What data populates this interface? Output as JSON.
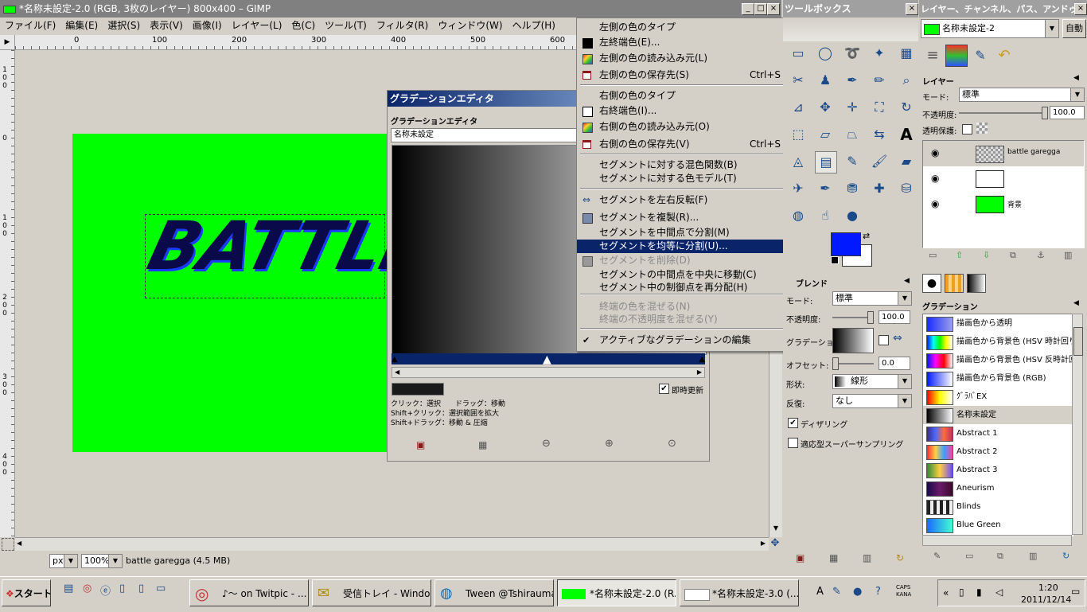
{
  "gimp_window": {
    "title": "*名称未設定-2.0 (RGB, 3枚のレイヤー) 800x400 – GIMP",
    "menu": [
      "ファイル(F)",
      "編集(E)",
      "選択(S)",
      "表示(V)",
      "画像(I)",
      "レイヤー(L)",
      "色(C)",
      "ツール(T)",
      "フィルタ(R)",
      "ウィンドウ(W)",
      "ヘルプ(H)"
    ],
    "ruler_top": [
      "0",
      "100",
      "200",
      "300",
      "400",
      "500",
      "600"
    ],
    "ruler_left": [
      [
        "1",
        "0",
        "0"
      ],
      [
        "0"
      ],
      [
        "1",
        "0",
        "0"
      ],
      [
        "2",
        "0",
        "0"
      ],
      [
        "3",
        "0",
        "0"
      ],
      [
        "4",
        "0",
        "0"
      ]
    ],
    "canvas_color": "#00ff00",
    "canvas_text": "BATTLE",
    "status_unit": "px",
    "status_zoom": "100%",
    "status_text": "battle garegga (4.5 MB)"
  },
  "gradient_editor": {
    "title": "グラデーションエディタ",
    "heading": "グラデーションエディタ",
    "name_value": "名称未設定",
    "hint1": "クリック：選択　　ドラッグ：移動",
    "hint2": "Shift+クリック：選択範囲を拡大",
    "hint3": "Shift+ドラッグ：移動 & 圧縮",
    "instant_update": "即時更新",
    "instant_checked": "✔"
  },
  "context_menu": {
    "items": [
      {
        "label": "左側の色のタイプ",
        "shortcut": "",
        "arrow": "▶",
        "icon": "none"
      },
      {
        "label": "左終端色(E)...",
        "shortcut": "",
        "arrow": "",
        "icon": "black-swatch"
      },
      {
        "label": "左側の色の読み込み元(L)",
        "shortcut": "",
        "arrow": "▶",
        "icon": "palette"
      },
      {
        "label": "左側の色の保存先(S)",
        "shortcut": "Ctrl+S",
        "arrow": "▶",
        "icon": "save"
      },
      {
        "label": "右側の色のタイプ",
        "shortcut": "",
        "arrow": "▶",
        "icon": "none"
      },
      {
        "label": "右終端色(I)...",
        "shortcut": "",
        "arrow": "",
        "icon": "white-swatch"
      },
      {
        "label": "右側の色の読み込み元(O)",
        "shortcut": "",
        "arrow": "▶",
        "icon": "palette"
      },
      {
        "label": "右側の色の保存先(V)",
        "shortcut": "Ctrl+S",
        "arrow": "▶",
        "icon": "save"
      },
      {
        "label": "セグメントに対する混色関数(B)",
        "shortcut": "",
        "arrow": "▶",
        "icon": "none"
      },
      {
        "label": "セグメントに対する色モデル(T)",
        "shortcut": "",
        "arrow": "▶",
        "icon": "none"
      },
      {
        "label": "セグメントを左右反転(F)",
        "shortcut": "",
        "arrow": "",
        "icon": "flip"
      },
      {
        "label": "セグメントを複製(R)...",
        "shortcut": "",
        "arrow": "",
        "icon": "duplicate"
      },
      {
        "label": "セグメントを中間点で分割(M)",
        "shortcut": "",
        "arrow": "",
        "icon": "none"
      },
      {
        "label": "セグメントを均等に分割(U)...",
        "shortcut": "",
        "arrow": "",
        "icon": "none"
      },
      {
        "label": "セグメントを削除(D)",
        "shortcut": "",
        "arrow": "",
        "icon": "trash"
      },
      {
        "label": "セグメントの中間点を中央に移動(C)",
        "shortcut": "",
        "arrow": "",
        "icon": "none"
      },
      {
        "label": "セグメント中の制御点を再分配(H)",
        "shortcut": "",
        "arrow": "",
        "icon": "none"
      },
      {
        "label": "終端の色を混ぜる(N)",
        "shortcut": "",
        "arrow": "",
        "icon": "none"
      },
      {
        "label": "終端の不透明度を混ぜる(Y)",
        "shortcut": "",
        "arrow": "",
        "icon": "none"
      },
      {
        "label": "アクティブなグラデーションの編集",
        "shortcut": "",
        "arrow": "",
        "icon": "check"
      }
    ]
  },
  "toolbox": {
    "title": "ツールボックス",
    "blend_title": "ブレンド",
    "mode_label": "モード:",
    "mode_value": "標準",
    "opacity_label": "不透明度:",
    "opacity_value": "100.0",
    "gradient_label": "グラデーション:",
    "offset_label": "オフセット:",
    "offset_value": "0.0",
    "shape_label": "形状:",
    "shape_value": "線形",
    "repeat_label": "反復:",
    "repeat_value": "なし",
    "dither_label": "ディザリング",
    "supersample_label": "適応型スーパーサンプリング",
    "fg_color": "#0019ff",
    "bg_color": "#ffffff"
  },
  "layers_panel": {
    "title": "レイヤー、チャンネル、パス、アンドゥ",
    "image_select": "名称未設定-2",
    "auto_btn": "自動",
    "heading": "レイヤー",
    "mode_label": "モード:",
    "mode_value": "標準",
    "opacity_label": "不透明度:",
    "opacity_value": "100.0",
    "lock_label": "透明保護:",
    "layers": [
      {
        "name": "battle garegga"
      },
      {
        "name": ""
      },
      {
        "name": "背景"
      }
    ]
  },
  "gradients_panel": {
    "heading": "グラデーション",
    "items": [
      {
        "name": "描画色から透明",
        "colors": "linear-gradient(90deg,#1a2bff,#9aa0e8)"
      },
      {
        "name": "描画色から背景色 (HSV 時計回り)",
        "colors": "linear-gradient(90deg,#0019ff,#00ffff,#00ff00,#ffff00,#ffffff)"
      },
      {
        "name": "描画色から背景色 (HSV 反時計回",
        "colors": "linear-gradient(90deg,#0019ff,#ff00ff,#ff0000,#ffffff)"
      },
      {
        "name": "描画色から背景色 (RGB)",
        "colors": "linear-gradient(90deg,#0019ff,#ffffff)"
      },
      {
        "name": "ｸﾞﾗﾊﾞEX",
        "colors": "linear-gradient(90deg,#ff0000,#ffff00,#ffffff)"
      },
      {
        "name": "名称未設定",
        "colors": "linear-gradient(90deg,#000000,#ffffff)"
      },
      {
        "name": "Abstract 1",
        "colors": "linear-gradient(90deg,#3a2a8a,#4a6aff,#ff6a3a,#c03060)"
      },
      {
        "name": "Abstract 2",
        "colors": "linear-gradient(90deg,#ff2a40,#ffd040,#3aa0ff,#ff40a0)"
      },
      {
        "name": "Abstract 3",
        "colors": "linear-gradient(90deg,#2a8a3a,#ffcf40,#6a4aff)"
      },
      {
        "name": "Aneurism",
        "colors": "linear-gradient(90deg,#1a0a4a,#6a1a6a,#3a0a2a)"
      },
      {
        "name": "Blinds",
        "colors": "repeating-linear-gradient(90deg,#222 0 4px,#eee 4px 8px)"
      },
      {
        "name": "Blue Green",
        "colors": "linear-gradient(90deg,#1a6aff,#40ffd0)"
      }
    ]
  },
  "taskbar": {
    "start": "スタート",
    "buttons": [
      {
        "label": "♪～ on Twitpic - ..."
      },
      {
        "label": "受信トレイ - Window..."
      },
      {
        "label": "Tween  @Tshirauma..."
      },
      {
        "label": "*名称未設定-2.0 (R..."
      },
      {
        "label": "*名称未設定-3.0 (..."
      }
    ],
    "ime": "CAPS KANA",
    "time": "1:20",
    "date": "2011/12/14"
  }
}
